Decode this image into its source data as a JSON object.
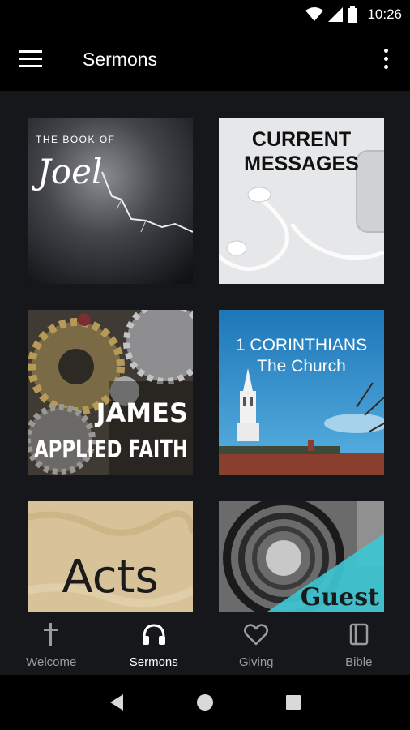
{
  "status_bar": {
    "time": "10:26"
  },
  "app_bar": {
    "title": "Sermons"
  },
  "series": [
    {
      "title_line1": "THE BOOK OF",
      "title_line2": "Joel"
    },
    {
      "title_line1": "CURRENT",
      "title_line2": "MESSAGES"
    },
    {
      "title_line1": "JAMES",
      "title_line2": "APPLIED FAITH"
    },
    {
      "title_line1": "1 CORINTHIANS",
      "title_line2": "The Church"
    },
    {
      "title_line1": "Acts"
    },
    {
      "title_line1": "Guest"
    }
  ],
  "bottom_nav": {
    "items": [
      {
        "label": "Welcome",
        "icon": "cross-icon"
      },
      {
        "label": "Sermons",
        "icon": "headphones-icon",
        "active": true
      },
      {
        "label": "Giving",
        "icon": "heart-icon"
      },
      {
        "label": "Bible",
        "icon": "book-icon"
      }
    ]
  },
  "colors": {
    "background": "#16171a",
    "bar": "#000000",
    "inactive": "#9a9b9e",
    "active": "#ffffff"
  }
}
